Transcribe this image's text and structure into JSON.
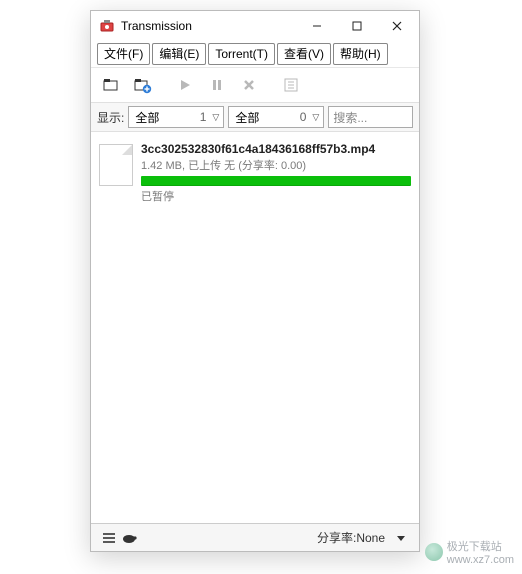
{
  "window": {
    "title": "Transmission"
  },
  "menu": {
    "file": "文件(F)",
    "edit": "编辑(E)",
    "torrent": "Torrent(T)",
    "view": "查看(V)",
    "help": "帮助(H)"
  },
  "filter": {
    "label": "显示:",
    "select1_value": "全部",
    "select1_count": "1",
    "select2_value": "全部",
    "select2_count": "0",
    "search_placeholder": "搜索..."
  },
  "torrent": {
    "name": "3cc302532830f61c4a18436168ff57b3.mp4",
    "meta": "1.42 MB, 已上传 无 (分享率: 0.00)",
    "status": "已暂停"
  },
  "status": {
    "ratio_label": "分享率: ",
    "ratio_value": "None"
  },
  "watermark": {
    "text": "极光下载站",
    "url": "www.xz7.com"
  }
}
